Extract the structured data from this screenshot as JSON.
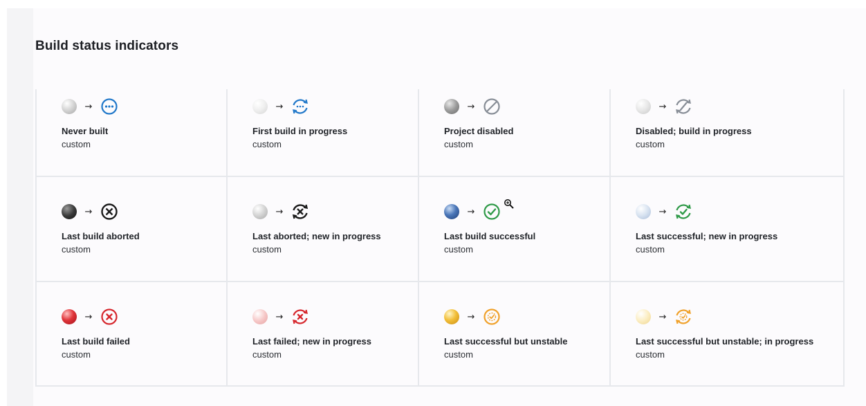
{
  "title": "Build status indicators",
  "indicators": [
    {
      "label": "Never built",
      "sub": "custom",
      "ball": "grey",
      "icon": "never-built-icon"
    },
    {
      "label": "First build in progress",
      "sub": "custom",
      "ball": "grey-light",
      "icon": "first-build-in-progress-icon"
    },
    {
      "label": "Project disabled",
      "sub": "custom",
      "ball": "grey-dark",
      "icon": "project-disabled-icon"
    },
    {
      "label": "Disabled; build in progress",
      "sub": "custom",
      "ball": "grey-light",
      "icon": "disabled-in-progress-icon"
    },
    {
      "label": "Last build aborted",
      "sub": "custom",
      "ball": "black",
      "icon": "aborted-icon"
    },
    {
      "label": "Last aborted; new in progress",
      "sub": "custom",
      "ball": "grey",
      "icon": "aborted-in-progress-icon"
    },
    {
      "label": "Last build successful",
      "sub": "custom",
      "ball": "blue",
      "icon": "success-icon"
    },
    {
      "label": "Last successful; new in progress",
      "sub": "custom",
      "ball": "blue-light",
      "icon": "success-in-progress-icon"
    },
    {
      "label": "Last build failed",
      "sub": "custom",
      "ball": "red",
      "icon": "failed-icon"
    },
    {
      "label": "Last failed; new in progress",
      "sub": "custom",
      "ball": "red-light",
      "icon": "failed-in-progress-icon"
    },
    {
      "label": "Last successful but unstable",
      "sub": "custom",
      "ball": "yellow",
      "icon": "unstable-icon"
    },
    {
      "label": "Last successful but unstable; in progress",
      "sub": "custom",
      "ball": "yellow-light",
      "icon": "unstable-in-progress-icon"
    }
  ],
  "colors": {
    "blue": "#1f77c9",
    "grey": "#878d96",
    "black": "#1a1a1a",
    "green": "#2f9a48",
    "red": "#d6262c",
    "orange": "#f0a12a",
    "border": "#e6e8ec"
  }
}
